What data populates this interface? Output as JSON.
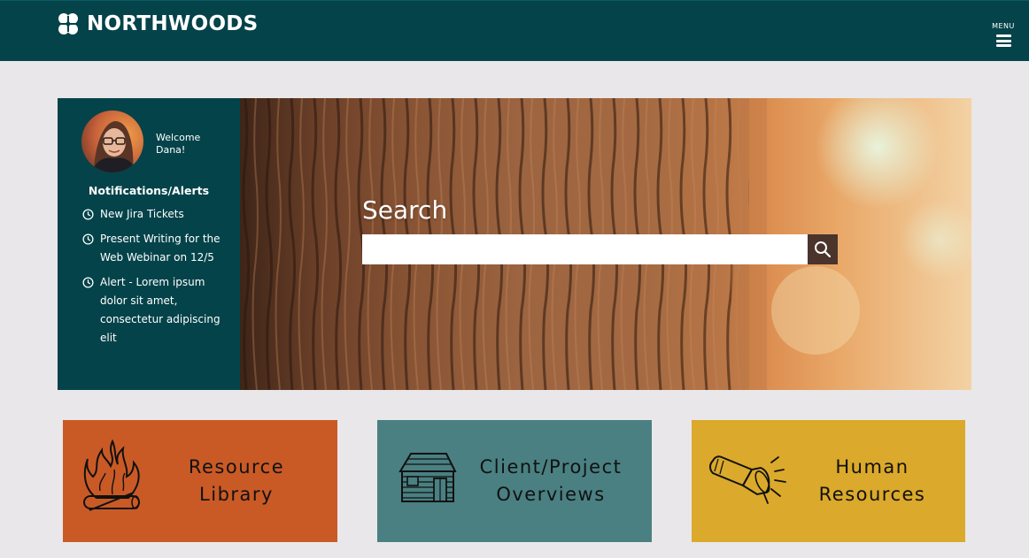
{
  "header": {
    "brand": "NORTHWOODS",
    "menu_label": "MENU"
  },
  "user": {
    "welcome_line1": "Welcome",
    "welcome_line2": "Dana!"
  },
  "notifications": {
    "title": "Notifications/Alerts",
    "items": [
      "New Jira Tickets",
      "Present Writing for the Web Webinar on 12/5",
      "Alert - Lorem ipsum dolor sit amet, consectetur adipiscing elit"
    ]
  },
  "search": {
    "heading": "Search",
    "value": "",
    "placeholder": ""
  },
  "tiles": [
    {
      "line1": "Resource",
      "line2": "Library",
      "icon": "campfire-icon",
      "color": "#c95a26"
    },
    {
      "line1": "Client/Project",
      "line2": "Overviews",
      "icon": "cabin-icon",
      "color": "#4a8082"
    },
    {
      "line1": "Human",
      "line2": "Resources",
      "icon": "flashlight-icon",
      "color": "#dba92b"
    }
  ],
  "colors": {
    "header_bg": "#04434a",
    "page_bg": "#e9e7e9",
    "search_button": "#4a342c"
  }
}
